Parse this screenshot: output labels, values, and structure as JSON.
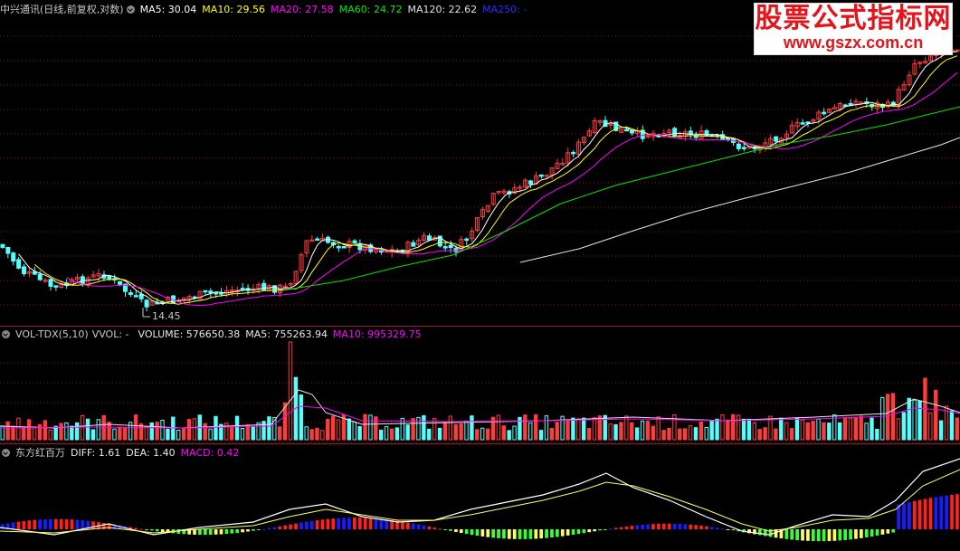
{
  "price_header": {
    "title": "中兴通讯(日线,前复权,对数)",
    "ma5": "MA5: 30.04",
    "ma10": "MA10: 29.56",
    "ma20": "MA20: 27.58",
    "ma60": "MA60: 24.72",
    "ma120": "MA120: 22.62",
    "ma250": "MA250: -"
  },
  "low_marker": "14.45",
  "vol_header": {
    "title": "VOL-TDX(5,10)",
    "vvol": "VVOL: -",
    "volume": "VOLUME: 576650.38",
    "ma5": "MA5: 755263.94",
    "ma10": "MA10: 995329.75"
  },
  "macd_header": {
    "title": "东方红百万",
    "diff": "DIFF: 1.61",
    "dea": "DEA: 1.40",
    "macd": "MACD: 0.42"
  },
  "logo": {
    "title": "股票公式指标网",
    "url": "www.gszx.com.cn"
  },
  "colors": {
    "up": "#ff3c3c",
    "down": "#54ffff",
    "ma5": "#ffffff",
    "ma10": "#ffff00",
    "ma20": "#ff00ff",
    "ma60": "#00e600",
    "ma250": "#0000ff",
    "grid": "#8a1010",
    "macd_red": "#ff2020",
    "macd_blue": "#1b1bff",
    "macd_green": "#38ff38",
    "macd_yellow": "#ffff60"
  }
}
